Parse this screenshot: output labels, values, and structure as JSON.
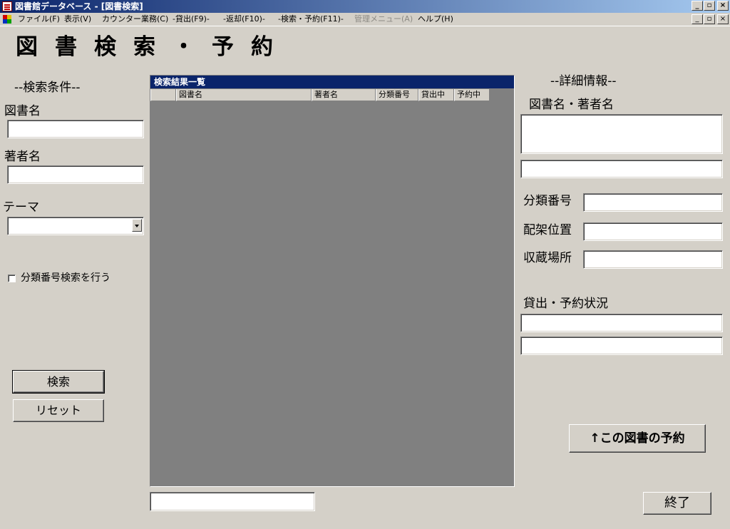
{
  "window": {
    "title": "図書館データベース - [図書検索]",
    "minimize": "_",
    "restore": "▫",
    "close": "×"
  },
  "menu": [
    {
      "label": "ファイル(F)",
      "enabled": true
    },
    {
      "label": "表示(V)",
      "enabled": true
    },
    {
      "label": "カウンター業務(C)",
      "enabled": true
    },
    {
      "label": "-貸出(F9)-",
      "enabled": true
    },
    {
      "label": "-返却(F10)-",
      "enabled": true
    },
    {
      "label": "-検索・予約(F11)-",
      "enabled": true
    },
    {
      "label": "管理メニュー(A)",
      "enabled": false
    },
    {
      "label": "ヘルプ(H)",
      "enabled": true
    }
  ],
  "page": {
    "title": "図書検索・予約"
  },
  "search": {
    "heading": "--検索条件--",
    "book_title_label": "図書名",
    "book_title_value": "",
    "author_label": "著者名",
    "author_value": "",
    "theme_label": "テーマ",
    "theme_value": "",
    "classify_checkbox_label": "分類番号検索を行う",
    "classify_checked": false,
    "search_button": "検索",
    "reset_button": "リセット"
  },
  "results": {
    "caption": "検索結果一覧",
    "columns": [
      "",
      "図書名",
      "著者名",
      "分類番号",
      "貸出中",
      "予約中"
    ],
    "rows": [],
    "status_value": ""
  },
  "detail": {
    "heading": "--詳細情報--",
    "title_author_label": "図書名・著者名",
    "title_author_value": "",
    "title_author_value2": "",
    "classification_label": "分類番号",
    "classification_value": "",
    "shelf_label": "配架位置",
    "shelf_value": "",
    "storage_label": "収蔵場所",
    "storage_value": "",
    "status_label": "貸出・予約状況",
    "status_value1": "",
    "status_value2": "",
    "reserve_button": "↑この図書の予約",
    "exit_button": "終了"
  }
}
